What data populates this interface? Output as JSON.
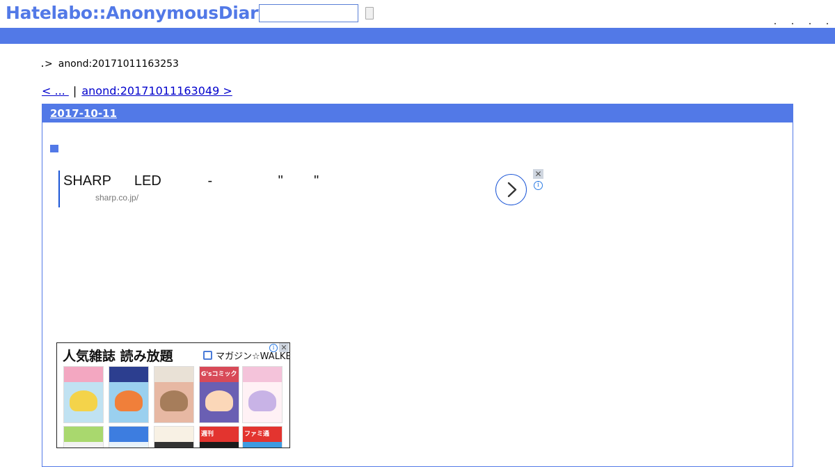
{
  "header": {
    "logo": "Hatelabo::AnonymousDiary",
    "search": {
      "value": "",
      "placeholder": ""
    },
    "search_button_label": ""
  },
  "breadcrumb": {
    "separator": ">",
    "current": "anond:20171011163253"
  },
  "pager": {
    "prev_label": "< ... ",
    "divider": "|",
    "next_label": "anond:20171011163049 >"
  },
  "day": {
    "date": "2017-10-11",
    "section_mark": ""
  },
  "text_ad": {
    "title": "SHARP      LED            -                 \"        \"",
    "url": "sharp.co.jp/",
    "close_symbol": "✕",
    "info_symbol": "i",
    "arrow_symbol": "›"
  },
  "image_ad": {
    "headline": "人気雑誌 読み放題",
    "brand": "マガジン☆WALKER",
    "close_symbol": "✕",
    "info_symbol": "i",
    "covers": [
      {
        "label": "",
        "colors": [
          "#f3a7c1",
          "#f4d34a",
          "#c0e2f2"
        ]
      },
      {
        "label": "",
        "colors": [
          "#2c3e8f",
          "#f07f3a",
          "#9ad0ef"
        ]
      },
      {
        "label": "",
        "colors": [
          "#e9e1d6",
          "#a67d5b",
          "#e7b8a3"
        ]
      },
      {
        "label": "G'sコミック",
        "colors": [
          "#d84a58",
          "#fbd7b8",
          "#6a5fb3"
        ]
      },
      {
        "label": "",
        "colors": [
          "#f4c3da",
          "#c8b3e6",
          "#fff1f5"
        ]
      },
      {
        "label": "",
        "colors": [
          "#a9d86e",
          "#f6e27a",
          "#f2f2f2"
        ]
      },
      {
        "label": "",
        "colors": [
          "#3d7de0",
          "#4bb6e8",
          "#e7f2fb"
        ]
      },
      {
        "label": "",
        "colors": [
          "#f8f1e4",
          "#e77b5b",
          "#333333"
        ]
      },
      {
        "label": "週刊",
        "colors": [
          "#e3342f",
          "#f6d847",
          "#1a1a1a"
        ]
      },
      {
        "label": "ファミ通",
        "colors": [
          "#e3342f",
          "#ffffff",
          "#3e9be0"
        ]
      }
    ]
  },
  "colors": {
    "brand_blue": "#5279e7",
    "link": "#0000cc",
    "ad_blue": "#1a55d6"
  }
}
